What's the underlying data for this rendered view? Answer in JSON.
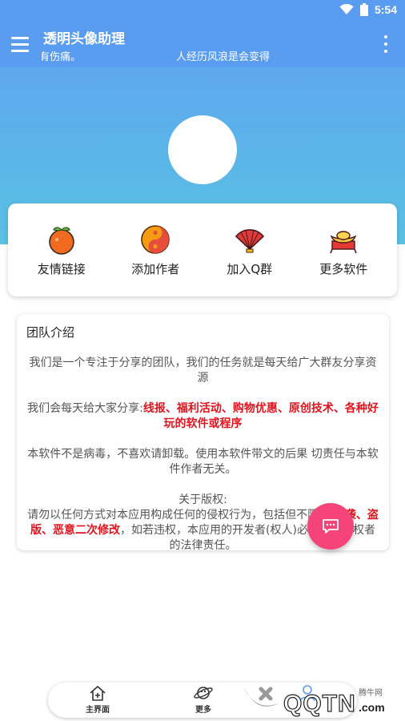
{
  "status_bar": {
    "time": "5:54"
  },
  "app_bar": {
    "title": "透明头像助理",
    "marquee_left": "有伤痛。",
    "marquee_right": "人经历风浪是会变得"
  },
  "quick_links": [
    {
      "label": "友情链接",
      "icon": "orange-icon"
    },
    {
      "label": "添加作者",
      "icon": "yin-yang-icon"
    },
    {
      "label": "加入Q群",
      "icon": "fan-icon"
    },
    {
      "label": "更多软件",
      "icon": "gold-ingot-icon"
    }
  ],
  "team": {
    "title": "团队介绍",
    "p1": "我们是一个专注于分享的团队，我们的任务就是每天给广大群友分享资源",
    "p2_prefix": "我们会每天给大家分享:",
    "p2_highlight": "线报、福利活动、购物优惠、原创技术、各种好玩的软件或程序",
    "p3": "本软件不是病毒，不喜欢请卸载。使用本软件带文的后果  切责任与本软件作者无关。",
    "p4_heading": "关于版权:",
    "p4_prefix": "请勿以任何方式对本应用构成任何的侵权行为，包括但不限于:",
    "p4_highlight": "抄袭、盗版、恶意二次修改",
    "p4_suffix": "，如若违权，本应用的开发者(权人)必当追究侵权者的法律责任。"
  },
  "bottom_nav": [
    {
      "label": "主界面",
      "icon": "home-icon"
    },
    {
      "label": "更多",
      "icon": "planet-icon"
    },
    {
      "label": "",
      "icon": "person-icon"
    }
  ],
  "watermark": {
    "text": "腾牛网",
    "logo": "QQTN.com"
  },
  "colors": {
    "primary": "#5a9cf0",
    "hero_bottom": "#59c1e3",
    "accent": "#f4447a",
    "highlight": "#e0141e"
  }
}
